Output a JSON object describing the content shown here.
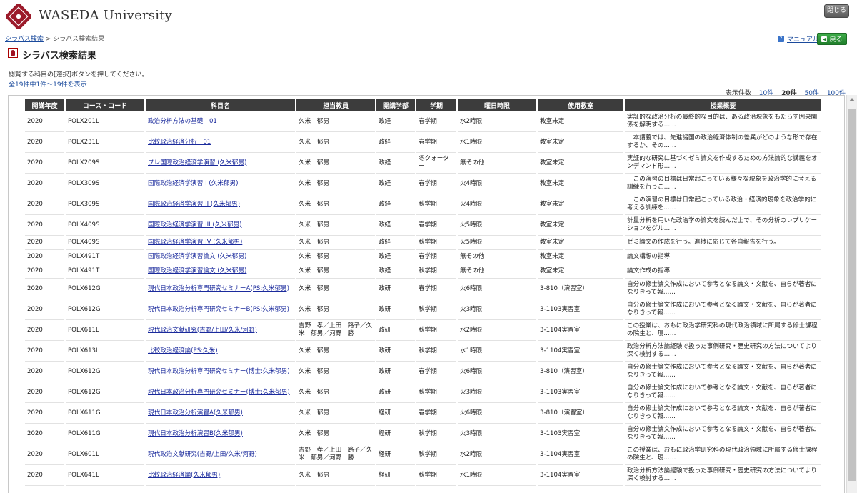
{
  "header": {
    "logo_text": "WASEDA University",
    "close_label": "閉じる"
  },
  "breadcrumb": {
    "link": "シラバス検索",
    "sep": " > ",
    "current": "シラバス検索結果"
  },
  "toolbar": {
    "manual_label": "マニュアル",
    "back_label": "戻る"
  },
  "page": {
    "title": "シラバス検索結果",
    "instruction": "閲覧する科目の[選択]ボタンを押してください。",
    "count": "全19件中1件〜19件を表示",
    "perpage_label": "表示件数",
    "perpage_options": [
      "10件",
      "20件",
      "50件",
      "100件"
    ],
    "perpage_selected": "20件"
  },
  "table": {
    "headers": [
      "開講年度",
      "コース・コード",
      "科目名",
      "担当教員",
      "開講学部",
      "学期",
      "曜日時限",
      "使用教室",
      "授業概要"
    ],
    "rows": [
      [
        "2020",
        "POLX201L",
        "政治分析方法の基礎　01",
        "久米　郁男",
        "政経",
        "春学期",
        "水2時限",
        "教室未定",
        "実証的な政治分析の最終的な目的は、ある政治現象をもたらす因果関係を解明する……"
      ],
      [
        "2020",
        "POLX231L",
        "比較政治経済分析　01",
        "久米　郁男",
        "政経",
        "春学期",
        "水1時限",
        "教室未定",
        "　本講義では、先進諸国の政治経済体制の差異がどのような形で存在するか、その……"
      ],
      [
        "2020",
        "POLX209S",
        "プレ国際政治経済学演習 (久米郁男)",
        "久米　郁男",
        "政経",
        "冬クォーター",
        "無その他",
        "教室未定",
        "実証的な研究に基づくゼミ論文を作成するための方法論的な講義をオンデマンド形……"
      ],
      [
        "2020",
        "POLX309S",
        "国際政治経済学演習 I (久米郁男)",
        "久米　郁男",
        "政経",
        "春学期",
        "火4時限",
        "教室未定",
        "　この演習の目標は日常起こっている様々な現象を政治学的に考える訓練を行うこ……"
      ],
      [
        "2020",
        "POLX309S",
        "国際政治経済学演習 II (久米郁男)",
        "久米　郁男",
        "政経",
        "秋学期",
        "火4時限",
        "教室未定",
        "　この演習の目標は日常起こっている政治・経済的現象を政治学的に考える訓練を……"
      ],
      [
        "2020",
        "POLX409S",
        "国際政治経済学演習 III (久米郁男)",
        "久米　郁男",
        "政経",
        "春学期",
        "火5時限",
        "教室未定",
        "計量分析を用いた政治学の論文を読んだ上で、その分析のレプリケーションをグル……"
      ],
      [
        "2020",
        "POLX409S",
        "国際政治経済学演習 IV (久米郁男)",
        "久米　郁男",
        "政経",
        "秋学期",
        "火5時限",
        "教室未定",
        "ゼミ論文の作成を行う。進捗に応じて各自報告を行う。"
      ],
      [
        "2020",
        "POLX491T",
        "国際政治経済学演習論文 (久米郁男)",
        "久米　郁男",
        "政経",
        "春学期",
        "無その他",
        "教室未定",
        "論文構想の指導"
      ],
      [
        "2020",
        "POLX491T",
        "国際政治経済学演習論文 (久米郁男)",
        "久米　郁男",
        "政経",
        "秋学期",
        "無その他",
        "教室未定",
        "論文作成の指導"
      ],
      [
        "2020",
        "POLX612G",
        "現代日本政治分析専門研究セミナーA(PS:久米郁男)",
        "久米　郁男",
        "政研",
        "春学期",
        "火6時限",
        "3-810（演習室）",
        "自分の修士論文作成において参考となる論文・文献を、自らが著者になりきって報……"
      ],
      [
        "2020",
        "POLX612G",
        "現代日本政治分析専門研究セミナーB(PS:久米郁男)",
        "久米　郁男",
        "政研",
        "秋学期",
        "火3時限",
        "3-1103実習室",
        "自分の修士論文作成において参考となる論文・文献を、自らが著者になりきって報……"
      ],
      [
        "2020",
        "POLX611L",
        "現代政治文献研究(吉野/上田/久米/河野)",
        "吉野　孝／上田　路子／久米　郁男／河野　勝",
        "政研",
        "秋学期",
        "水2時限",
        "3-1104実習室",
        "この授業は、おもに政治学研究科の現代政治領域に所属する修士課程の院生と、現……"
      ],
      [
        "2020",
        "POLX613L",
        "比較政治経済論(PS:久米)",
        "久米　郁男",
        "政研",
        "秋学期",
        "水1時限",
        "3-1104実習室",
        "政治分析方法論経験で扱った事例研究・歴史研究の方法についてより深く検討する……"
      ],
      [
        "2020",
        "POLX612G",
        "現代日本政治分析専門研究セミナー(博士:久米郁男)",
        "久米　郁男",
        "政研",
        "春学期",
        "火6時限",
        "3-810（演習室）",
        "自分の修士論文作成において参考となる論文・文献を、自らが著者になりきって報……"
      ],
      [
        "2020",
        "POLX612G",
        "現代日本政治分析専門研究セミナー(博士:久米郁男)",
        "久米　郁男",
        "政研",
        "秋学期",
        "火3時限",
        "3-1103実習室",
        "自分の修士論文作成において参考となる論文・文献を、自らが著者になりきって報……"
      ],
      [
        "2020",
        "POLX611G",
        "現代日本政治分析演習A(久米郁男)",
        "久米　郁男",
        "経研",
        "春学期",
        "火6時限",
        "3-810（演習室）",
        "自分の修士論文作成において参考となる論文・文献を、自らが著者になりきって報……"
      ],
      [
        "2020",
        "POLX611G",
        "現代日本政治分析演習B(久米郁男)",
        "久米　郁男",
        "経研",
        "秋学期",
        "火3時限",
        "3-1103実習室",
        "自分の修士論文作成において参考となる論文・文献を、自らが著者になりきって報……"
      ],
      [
        "2020",
        "POLX601L",
        "現代政治文献研究(吉野/上田/久米/河野)",
        "吉野　孝／上田　路子／久米　郁男／河野　勝",
        "経研",
        "秋学期",
        "水2時限",
        "3-1104実習室",
        "この授業は、おもに政治学研究科の現代政治領域に所属する修士課程の院生と、現……"
      ],
      [
        "2020",
        "POLX641L",
        "比較政治経済論(久米郁男)",
        "久米　郁男",
        "経研",
        "秋学期",
        "水1時限",
        "3-1104実習室",
        "政治分析方法論経験で扱った事例研究・歴史研究の方法についてより深く検討する……"
      ]
    ]
  }
}
